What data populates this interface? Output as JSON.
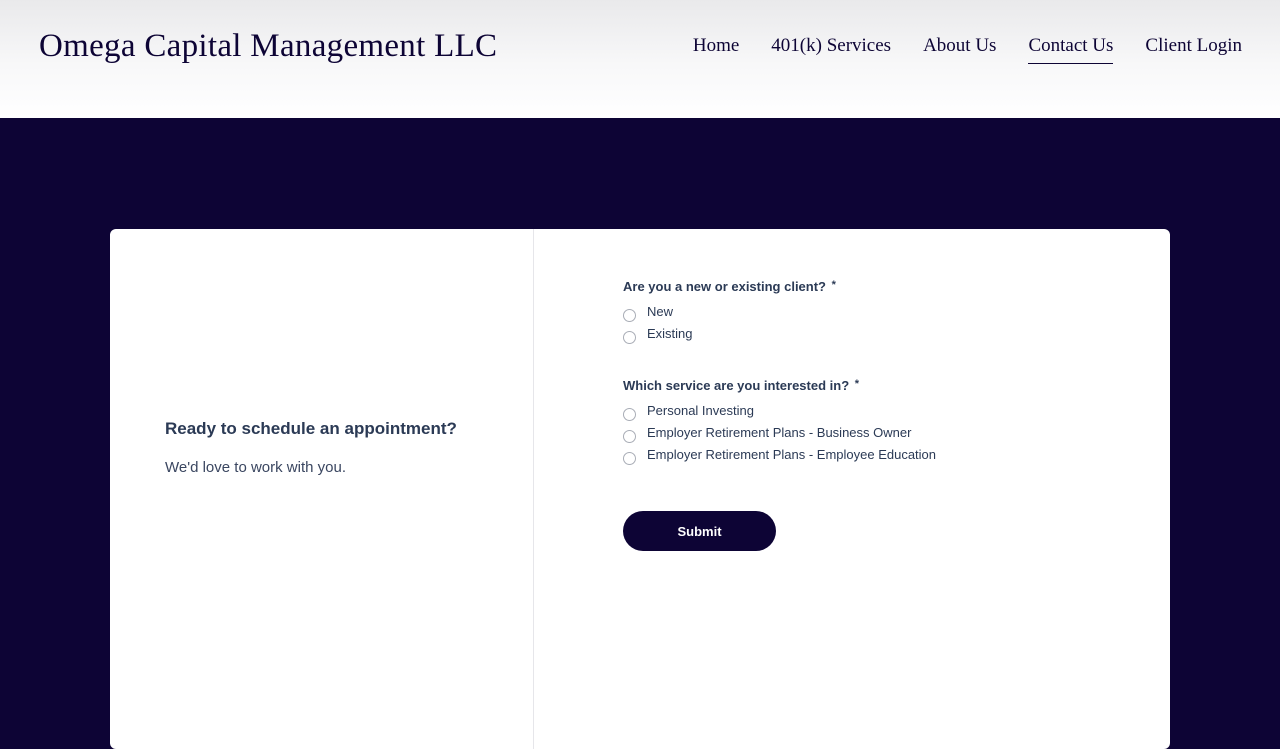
{
  "header": {
    "brand": "Omega Capital Management LLC",
    "nav": [
      "Home",
      "401(k) Services",
      "About Us",
      "Contact Us",
      "Client Login"
    ],
    "active_nav": "Contact Us"
  },
  "card": {
    "heading": "Ready to schedule an appointment?",
    "subtext": "We'd love to work with you.",
    "form": {
      "question1": {
        "label": "Are you a new or existing client?",
        "required_mark": "*",
        "options": [
          "New",
          "Existing"
        ]
      },
      "question2": {
        "label": "Which service are you interested in?",
        "required_mark": "*",
        "options": [
          "Personal Investing",
          "Employer Retirement Plans - Business Owner",
          "Employer Retirement Plans - Employee Education"
        ]
      },
      "submit_label": "Submit"
    }
  },
  "colors": {
    "brand_navy": "#0d0435",
    "text_slate": "#2b3a55",
    "card_bg": "#ffffff"
  }
}
